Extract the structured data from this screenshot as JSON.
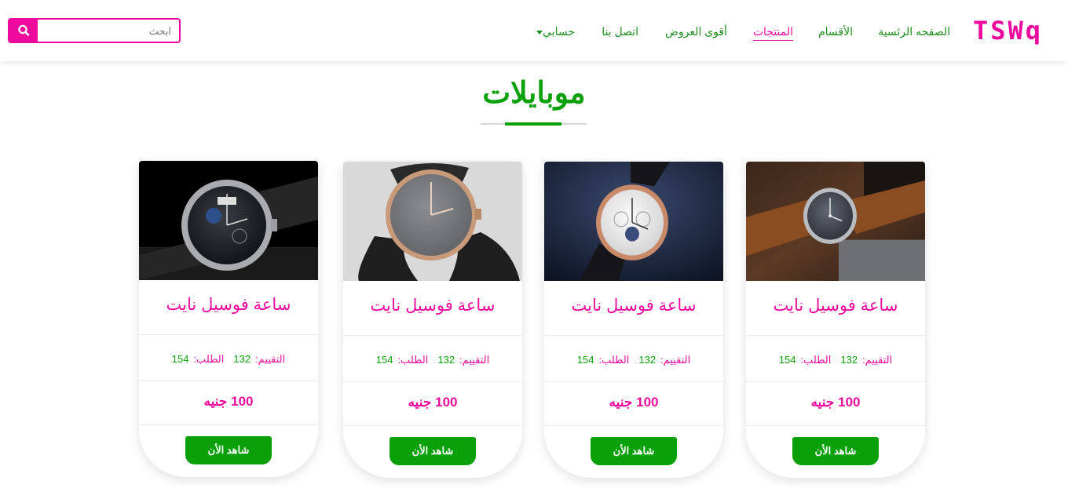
{
  "brand": {
    "logo": "TSWq",
    "color": "#ee0a9c",
    "accent": "#0aa00a"
  },
  "nav": {
    "items": [
      {
        "label": "الصفحه الرئسية",
        "active": false
      },
      {
        "label": "الأقسام",
        "active": false
      },
      {
        "label": "المنتجات",
        "active": true
      },
      {
        "label": "أقوى العروض",
        "active": false
      },
      {
        "label": "اتصل بنا",
        "active": false
      },
      {
        "label": "حسابي",
        "dropdown": true
      }
    ]
  },
  "search": {
    "placeholder": "ابحث",
    "value": "",
    "icon": "search-icon"
  },
  "section": {
    "title": "موبايلات"
  },
  "products": [
    {
      "title": "ساعة فوسيل نايت",
      "rating_label": "التقييم:",
      "rating": "132",
      "orders_label": "الطلب:",
      "orders": "154",
      "price": "100 جنيه",
      "cta": "شاهد الأن",
      "image": "watch-brown-leather"
    },
    {
      "title": "ساعة فوسيل نايت",
      "rating_label": "التقييم:",
      "rating": "132",
      "orders_label": "الطلب:",
      "orders": "154",
      "price": "100 جنيه",
      "cta": "شاهد الأن",
      "image": "watch-rose-gold-chronograph"
    },
    {
      "title": "ساعة فوسيل نايت",
      "rating_label": "التقييم:",
      "rating": "132",
      "orders_label": "الطلب:",
      "orders": "154",
      "price": "100 جنيه",
      "cta": "شاهد الأن",
      "image": "watch-grey-dial"
    },
    {
      "title": "ساعة فوسيل نايت",
      "rating_label": "التقييم:",
      "rating": "132",
      "orders_label": "الطلب:",
      "orders": "154",
      "price": "100 جنيه",
      "cta": "شاهد الأن",
      "image": "watch-black-moonphase"
    }
  ]
}
